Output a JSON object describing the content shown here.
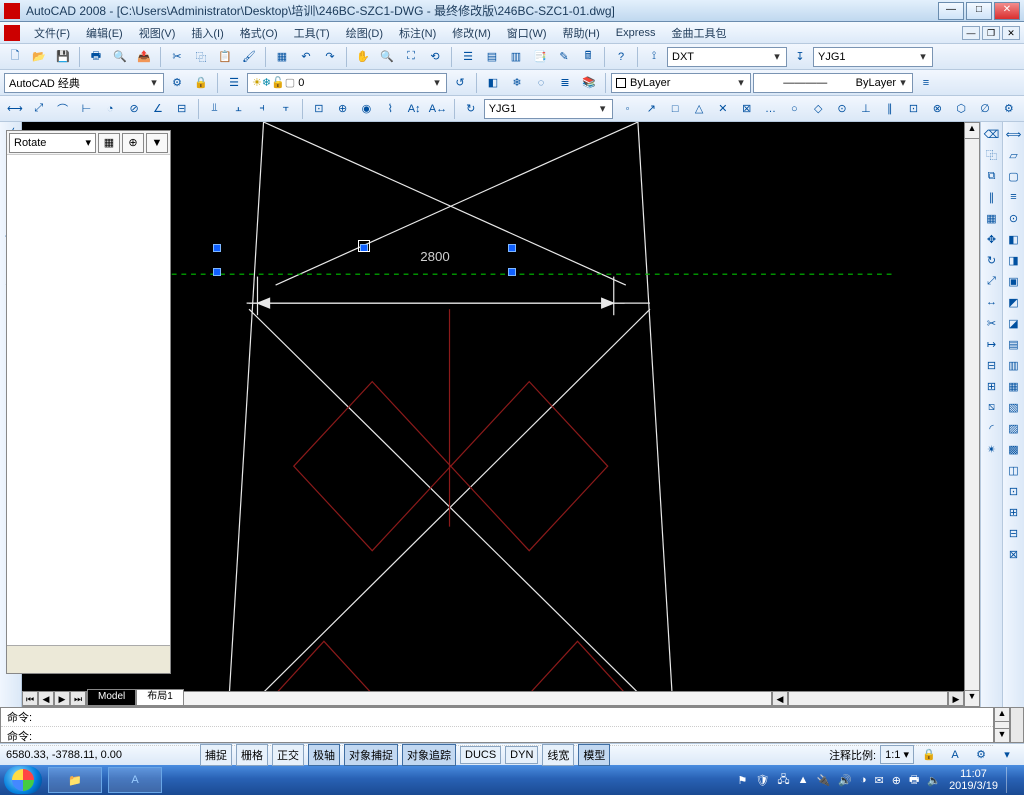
{
  "titlebar": {
    "text": "AutoCAD 2008 - [C:\\Users\\Administrator\\Desktop\\培训\\246BC-SZC1-DWG - 最终修改版\\246BC-SZC1-01.dwg]"
  },
  "menu": {
    "file": "文件(F)",
    "edit": "编辑(E)",
    "view": "视图(V)",
    "insert": "插入(I)",
    "format": "格式(O)",
    "tools": "工具(T)",
    "draw": "绘图(D)",
    "dim": "标注(N)",
    "modify": "修改(M)",
    "window": "窗口(W)",
    "help": "帮助(H)",
    "express": "Express",
    "jinqu": "金曲工具包"
  },
  "combos": {
    "workspace": "AutoCAD 经典",
    "layer": "0",
    "dimstyle1": "DXT",
    "dimstyle2": "YJG1",
    "linetype_color": "ByLayer",
    "linetype": "ByLayer",
    "yjg1": "YJG1"
  },
  "prop": {
    "label": "Rotate"
  },
  "tabs": {
    "model": "Model",
    "layout1": "布局1"
  },
  "cmd": {
    "l1": "命令:",
    "l2": "命令:"
  },
  "status": {
    "coords": "6580.33, -3788.11, 0.00",
    "snap": "捕捉",
    "grid": "栅格",
    "ortho": "正交",
    "polar": "极轴",
    "osnap": "对象捕捉",
    "otrack": "对象追踪",
    "ducs": "DUCS",
    "dyn": "DYN",
    "lwt": "线宽",
    "model": "模型",
    "annoscale_lbl": "注释比例:",
    "annoscale_val": "1:1"
  },
  "dim_text": "2800",
  "taskbar": {
    "time": "11:07",
    "date": "2019/3/19"
  }
}
